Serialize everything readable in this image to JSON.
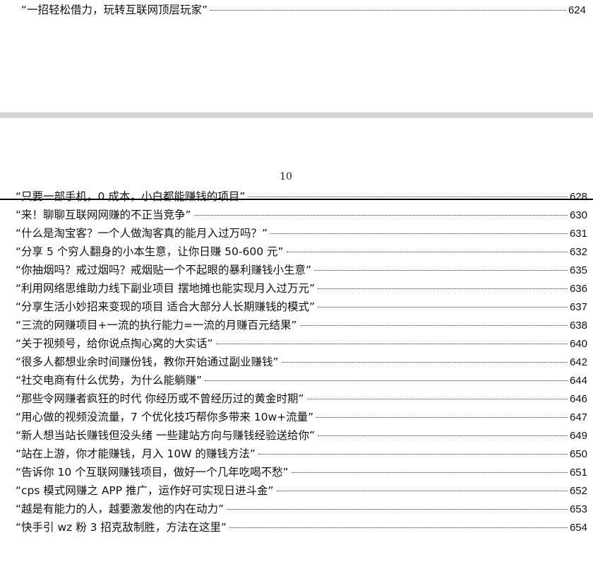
{
  "previous_page": {
    "entry": {
      "title": "“一招轻松借力，玩转互联网顶层玩家”",
      "page": "624"
    }
  },
  "current_page": {
    "page_number": "10",
    "toc_entries": [
      {
        "title": "“只要一部手机，0 成本，小白都能赚钱的项目”",
        "page": "628"
      },
      {
        "title": "“来！聊聊互联网网赚的不正当竞争”",
        "page": "630"
      },
      {
        "title": "“什么是淘宝客？一个人做淘客真的能月入过万吗？”",
        "page": "631"
      },
      {
        "title": "“分享 5 个穷人翻身的小本生意，让你日赚 50-600 元”",
        "page": "632"
      },
      {
        "title": "“你抽烟吗？戒过烟吗？戒烟贴一个不起眼的暴利赚钱小生意”",
        "page": "635"
      },
      {
        "title": "“利用网络思维助力线下副业项目  摆地摊也能实现月入过万元”",
        "page": "636"
      },
      {
        "title": "“分享生活小妙招来变现的项目  适合大部分人长期赚钱的模式”",
        "page": "637"
      },
      {
        "title": "“三流的网赚项目+一流的执行能力=一流的月赚百元结果”",
        "page": "638"
      },
      {
        "title": "“关于视频号，给你说点掏心窝的大实话”",
        "page": "640"
      },
      {
        "title": "“很多人都想业余时间赚份钱，教你开始通过副业赚钱”",
        "page": "642"
      },
      {
        "title": "“社交电商有什么优势，为什么能躺赚”",
        "page": "644"
      },
      {
        "title": "“那些令网赚者疯狂的时代  你经历或不曾经历过的黄金时期”",
        "page": "646"
      },
      {
        "title": "“用心做的视频没流量，7 个优化技巧帮你多带来 10w+流量”",
        "page": "647"
      },
      {
        "title": "“新人想当站长赚钱但没头绪  一些建站方向与赚钱经验送给你”",
        "page": "649"
      },
      {
        "title": "“站在上游，你才能赚钱，月入 10W 的赚钱方法”",
        "page": "650"
      },
      {
        "title": "“告诉你 10 个互联网赚钱项目，做好一个几年吃喝不愁”",
        "page": "651"
      },
      {
        "title": "“cps 模式网赚之 APP 推广，运作好可实现日进斗金”",
        "page": "652"
      },
      {
        "title": "“越是有能力的人，越要激发他的内在动力”",
        "page": "653"
      },
      {
        "title": "“快手引 wz 粉 3 招克敌制胜，方法在这里”",
        "page": "654"
      }
    ]
  }
}
